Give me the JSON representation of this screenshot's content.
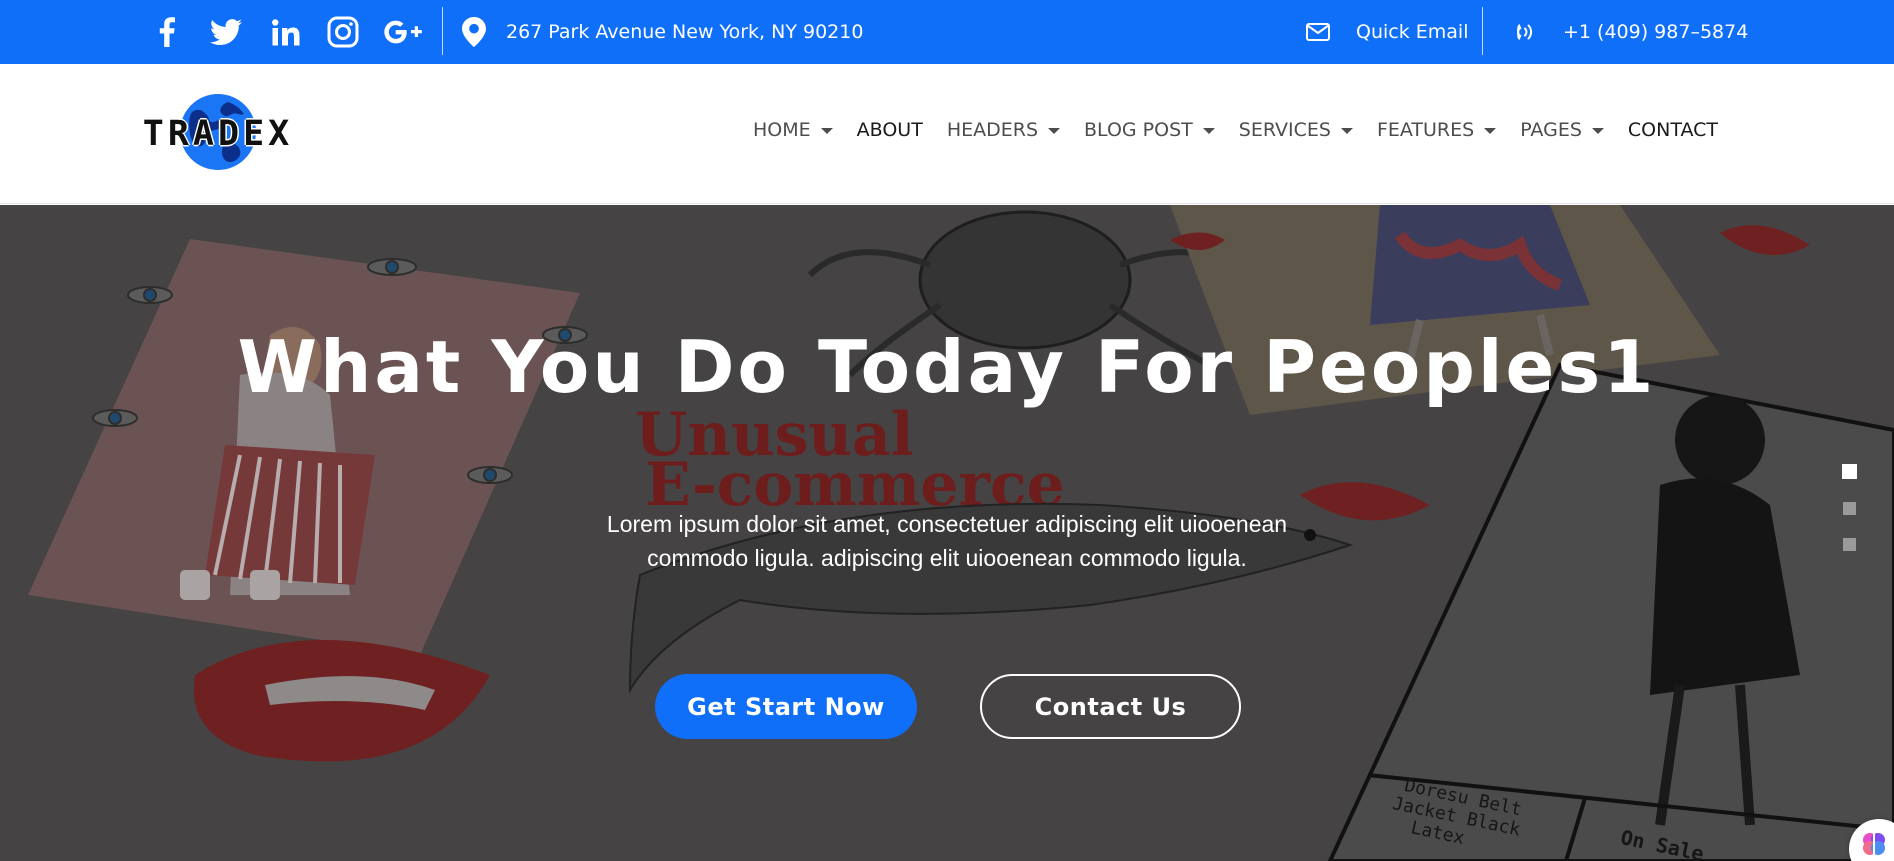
{
  "topbar": {
    "background": "#0f6ff9",
    "social": [
      {
        "name": "facebook-icon"
      },
      {
        "name": "twitter-icon"
      },
      {
        "name": "linkedin-icon"
      },
      {
        "name": "instagram-icon"
      },
      {
        "name": "google-plus-icon"
      }
    ],
    "address": "267 Park Avenue New York, NY 90210",
    "email_label": "Quick Email",
    "phone": "+1 (409) 987–5874"
  },
  "header": {
    "logo_text": "TRADEX",
    "nav": [
      {
        "label": "HOME",
        "dropdown": true
      },
      {
        "label": "ABOUT",
        "dropdown": false
      },
      {
        "label": "HEADERS",
        "dropdown": true
      },
      {
        "label": "BLOG POST",
        "dropdown": true
      },
      {
        "label": "SERVICES",
        "dropdown": true
      },
      {
        "label": "FEATURES",
        "dropdown": true
      },
      {
        "label": "PAGES",
        "dropdown": true
      },
      {
        "label": "CONTACT",
        "dropdown": false
      }
    ]
  },
  "hero": {
    "title": "What You Do Today For Peoples1",
    "subtitle": "Lorem ipsum dolor sit amet, consectetuer adipiscing elit uiooenean commodo ligula. adipiscing elit uiooenean commodo ligula.",
    "primary_button": "Get Start Now",
    "secondary_button": "Contact Us",
    "background_text": {
      "headline_1": "Unusual",
      "headline_2": "E-commerce",
      "card_line_1": "Doresu Belt",
      "card_line_2": "Jacket Black",
      "card_line_3": "Latex",
      "card_tag": "On Sale"
    },
    "slides": 3,
    "active_slide": 0
  },
  "colors": {
    "accent": "#0f6ff9",
    "overlay": "#444242"
  }
}
